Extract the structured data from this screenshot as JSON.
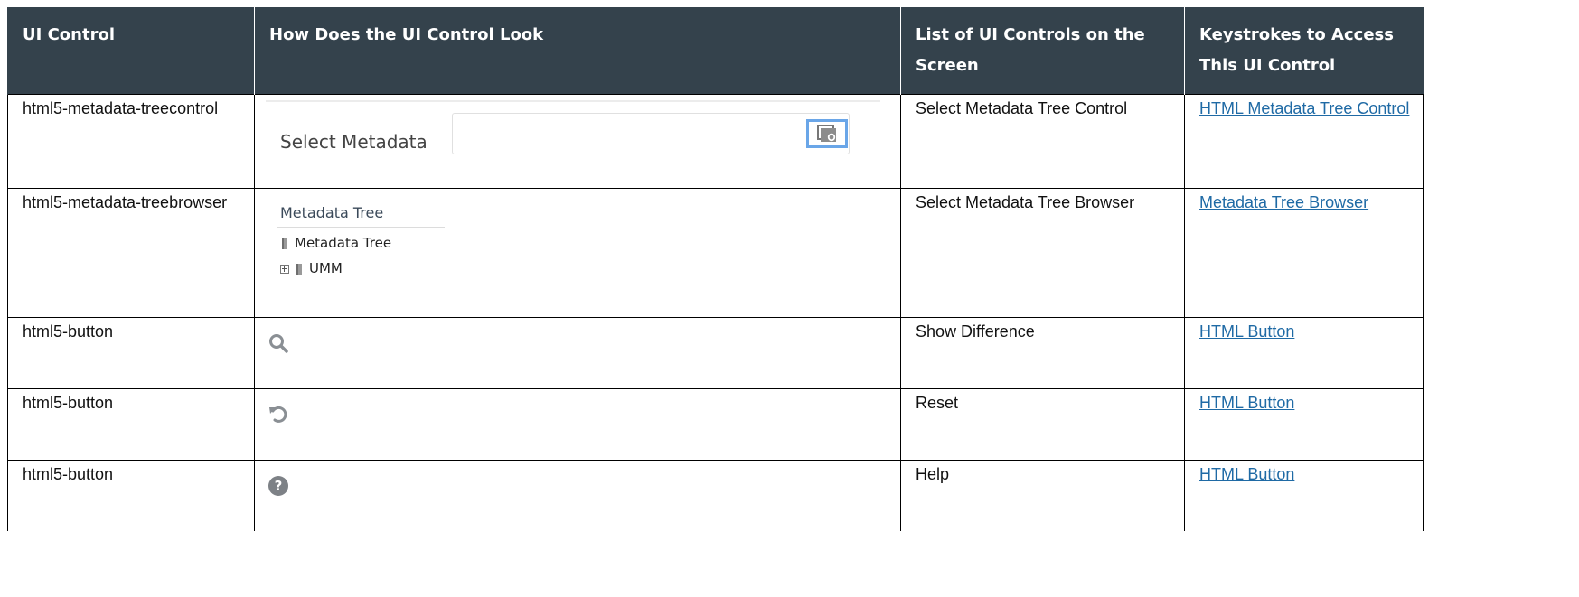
{
  "headers": [
    "UI Control",
    "How Does the UI Control Look",
    "List of UI Controls on the Screen",
    "Keystrokes to Access This UI Control"
  ],
  "rows": [
    {
      "ui_control": "html5-metadata-treecontrol",
      "screen_control": "Select Metadata Tree Control",
      "keystroke_link": "HTML Metadata Tree Control",
      "illustration": {
        "label": "Select Metadata",
        "icon": "metadata-picker-icon"
      }
    },
    {
      "ui_control": "html5-metadata-treebrowser",
      "screen_control": "Select Metadata Tree Browser",
      "keystroke_link": "Metadata Tree Browser",
      "illustration": {
        "title": "Metadata Tree",
        "nodes": [
          "Metadata Tree",
          "UMM"
        ]
      }
    },
    {
      "ui_control": "html5-button",
      "screen_control": "Show Difference",
      "keystroke_link": "HTML Button",
      "illustration": {
        "icon": "search-icon"
      }
    },
    {
      "ui_control": "html5-button",
      "screen_control": "Reset",
      "keystroke_link": "HTML Button",
      "illustration": {
        "icon": "reset-icon"
      }
    },
    {
      "ui_control": "html5-button",
      "screen_control": "Help",
      "keystroke_link": "HTML Button",
      "illustration": {
        "icon": "help-icon"
      }
    }
  ],
  "colors": {
    "header_bg": "#34424c",
    "link": "#1f6aa5",
    "icon_gray": "#8a8f94"
  }
}
